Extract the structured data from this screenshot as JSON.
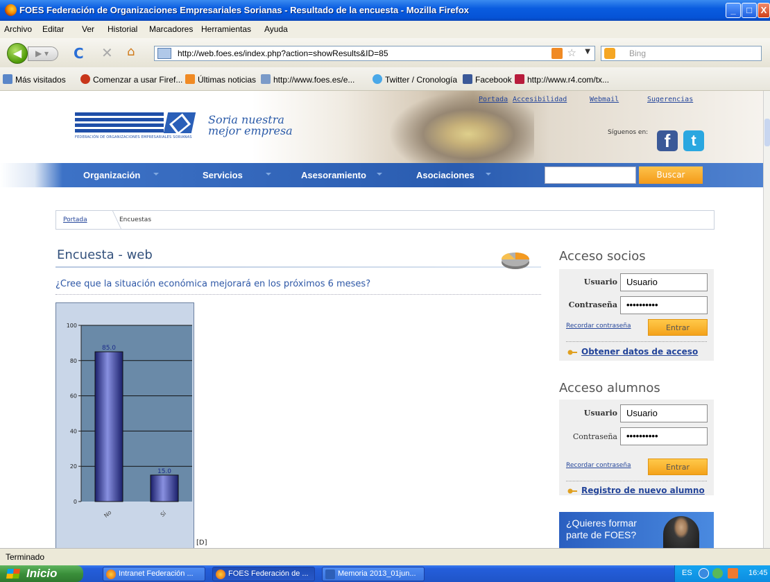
{
  "window": {
    "title": "FOES Federación de Organizaciones Empresariales Sorianas - Resultado de la encuesta - Mozilla Firefox",
    "controls": {
      "minimize": "_",
      "maximize": "□",
      "close": "X"
    }
  },
  "menu": [
    "Archivo",
    "Editar",
    "Ver",
    "Historial",
    "Marcadores",
    "Herramientas",
    "Ayuda"
  ],
  "toolbar": {
    "url": "http://web.foes.es/index.php?action=showResults&ID=85",
    "search_engine": "Bing",
    "icons": {
      "back": "back-arrow-icon",
      "forward": "forward-arrow-icon",
      "reload": "reload-icon",
      "stop": "stop-icon",
      "home": "home-icon"
    }
  },
  "bookmarks": [
    {
      "label": "Más visitados",
      "color": "#5a86c8"
    },
    {
      "label": "Comenzar a usar Firef...",
      "color": "#c8361a"
    },
    {
      "label": "Últimas noticias",
      "color": "#f08a24"
    },
    {
      "label": "http://www.foes.es/e...",
      "color": "#7a9ac8"
    },
    {
      "label": "Twitter / Cronología",
      "color": "#4aa8e8"
    },
    {
      "label": "Facebook",
      "color": "#3b5998"
    },
    {
      "label": "http://www.r4.com/tx...",
      "color": "#b81c3c"
    }
  ],
  "site": {
    "logo_text": "FOES",
    "logo_sub": "FEDERACIÓN DE ORGANIZACIONES EMPRESARIALES SORIANAS",
    "slogan_line1": "Soria nuestra",
    "slogan_line2": "mejor empresa",
    "top_links": [
      "Portada",
      "Accesibilidad",
      "Webmail",
      "Sugerencias"
    ],
    "follow_label": "Síguenos en:",
    "nav": [
      "Organización",
      "Servicios",
      "Asesoramiento",
      "Asociaciones"
    ],
    "search_button": "Buscar",
    "brand_color": "#2a5cb0",
    "accent_color": "#f4a21a"
  },
  "breadcrumb": {
    "home": "Portada",
    "current": "Encuestas"
  },
  "survey": {
    "section_title": "Encuesta - web",
    "question": "¿Cree que la situación económica mejorará en los próximos 6 meses?",
    "note": "[D]"
  },
  "chart_data": {
    "type": "bar",
    "categories": [
      "No",
      "Sí"
    ],
    "values": [
      85.0,
      15.0
    ],
    "value_labels": [
      "85.0",
      "15.0"
    ],
    "ylim": [
      0,
      100
    ],
    "yticks": [
      0,
      20,
      40,
      60,
      80,
      100
    ],
    "grid": true,
    "bar_color": "#3a3f9a",
    "background": "#6a8aa8",
    "title": "",
    "xlabel": "",
    "ylabel": ""
  },
  "login_socios": {
    "title": "Acceso socios",
    "user_label": "Usuario",
    "user_value": "Usuario",
    "pass_label": "Contraseña",
    "pass_value": "••••••••••",
    "remember": "Recordar contraseña",
    "submit": "Entrar",
    "extra_link": "Obtener datos de acceso"
  },
  "login_alumnos": {
    "title": "Acceso alumnos",
    "user_label": "Usuario",
    "user_value": "Usuario",
    "pass_label": "Contraseña",
    "pass_value": "••••••••••",
    "remember": "Recordar contraseña",
    "submit": "Entrar",
    "extra_link": "Registro de nuevo alumno"
  },
  "promo": {
    "text": "¿Quieres formar parte de FOES?"
  },
  "status": {
    "text": "Terminado"
  },
  "taskbar": {
    "start": "Inicio",
    "tasks": [
      "Intranet Federación ...",
      "FOES Federación de ...",
      "Memoria 2013_01jun..."
    ],
    "lang": "ES",
    "clock": "16:45"
  }
}
